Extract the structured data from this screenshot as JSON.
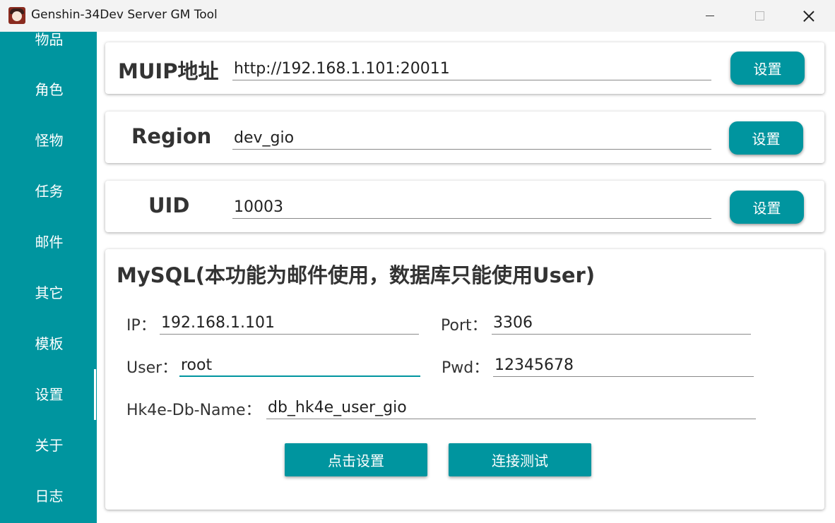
{
  "window": {
    "title": "Genshin-34Dev Server GM Tool",
    "icon": "app-avatar-icon"
  },
  "sidebar": {
    "items": [
      {
        "label": "物品"
      },
      {
        "label": "角色"
      },
      {
        "label": "怪物"
      },
      {
        "label": "任务"
      },
      {
        "label": "邮件"
      },
      {
        "label": "其它"
      },
      {
        "label": "模板"
      },
      {
        "label": "设置"
      },
      {
        "label": "关于"
      },
      {
        "label": "日志"
      }
    ],
    "selected": "设置"
  },
  "muip": {
    "label": "MUIP地址",
    "value": "http://192.168.1.101:20011",
    "button": "设置"
  },
  "region": {
    "label": "Region",
    "value": "dev_gio",
    "button": "设置"
  },
  "uid": {
    "label": "UID",
    "value": "10003",
    "button": "设置"
  },
  "mysql": {
    "title": "MySQL(本功能为邮件使用，数据库只能使用User)",
    "ip_label": "IP：",
    "ip_value": "192.168.1.101",
    "port_label": "Port：",
    "port_value": "3306",
    "user_label": "User：",
    "user_value": "root",
    "pwd_label": "Pwd：",
    "pwd_value": "12345678",
    "db_label": "Hk4e-Db-Name：",
    "db_value": "db_hk4e_user_gio",
    "apply_button": "点击设置",
    "test_button": "连接测试"
  },
  "colors": {
    "accent": "#00959f",
    "title_bar": "#f3f3f3"
  }
}
